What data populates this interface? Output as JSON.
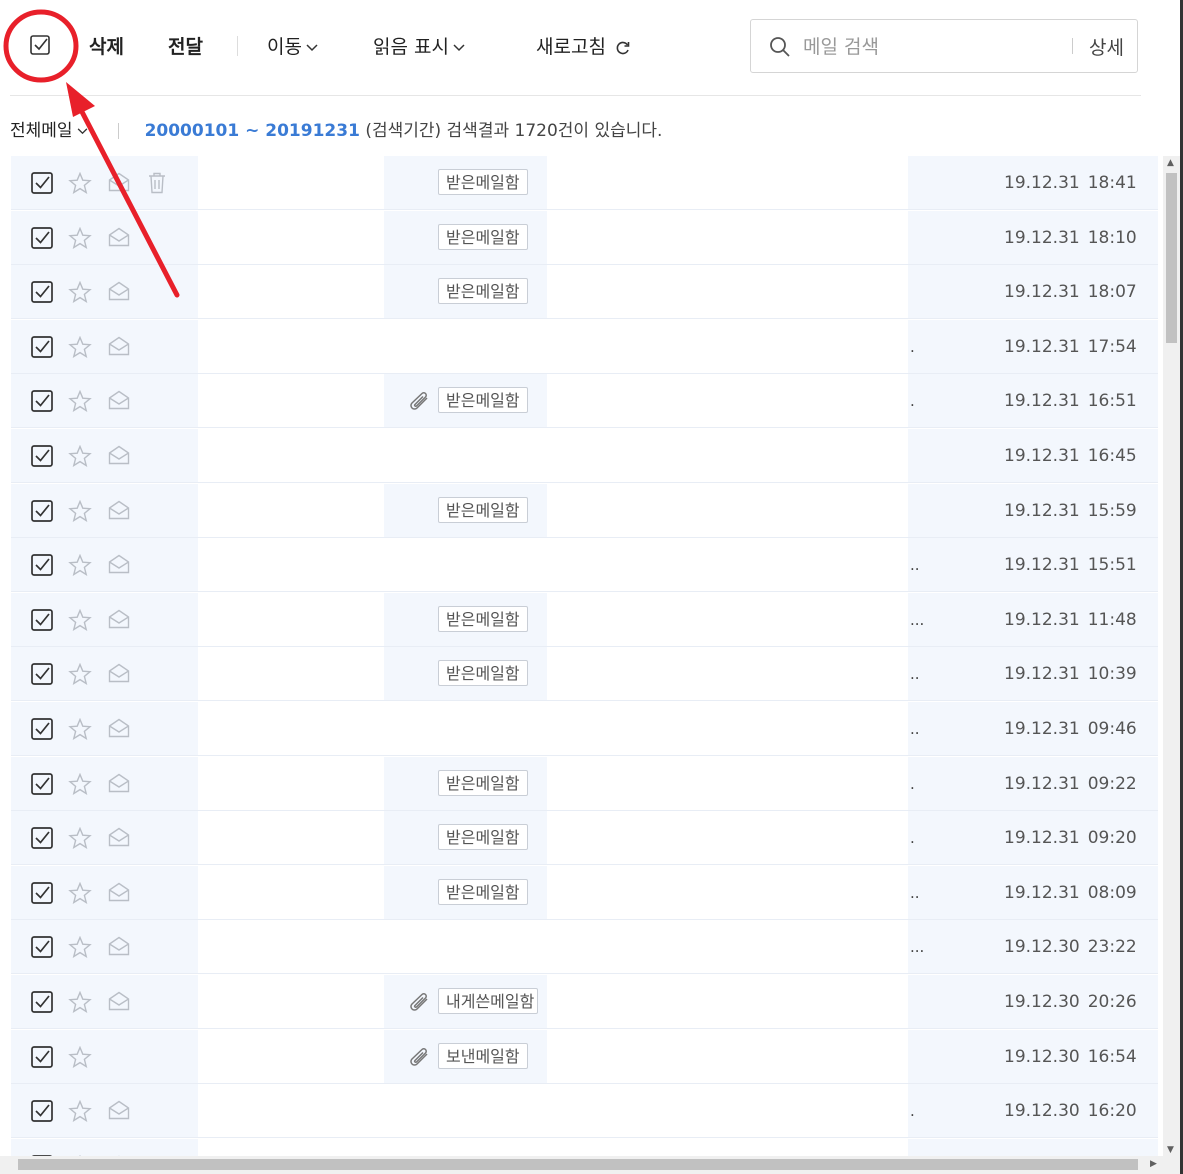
{
  "toolbar": {
    "delete_label": "삭제",
    "forward_label": "전달",
    "move_label": "이동",
    "mark_read_label": "읽음 표시",
    "refresh_label": "새로고침"
  },
  "search": {
    "placeholder": "메일 검색",
    "detail_label": "상세"
  },
  "filter": {
    "mailbox_label": "전체메일",
    "date_range": "20000101 ~ 20191231",
    "result_text": "(검색기간) 검색결과 1720건이 있습니다."
  },
  "emails": [
    {
      "folder": "받은메일함",
      "attachment": false,
      "date": "19.12.31",
      "time": "18:41",
      "tail": "",
      "read": true
    },
    {
      "folder": "받은메일함",
      "attachment": false,
      "date": "19.12.31",
      "time": "18:10",
      "tail": "",
      "read": true
    },
    {
      "folder": "받은메일함",
      "attachment": false,
      "date": "19.12.31",
      "time": "18:07",
      "tail": "",
      "read": true
    },
    {
      "folder": "",
      "attachment": false,
      "date": "19.12.31",
      "time": "17:54",
      "tail": ".",
      "read": true
    },
    {
      "folder": "받은메일함",
      "attachment": true,
      "date": "19.12.31",
      "time": "16:51",
      "tail": ".",
      "read": true
    },
    {
      "folder": "",
      "attachment": false,
      "date": "19.12.31",
      "time": "16:45",
      "tail": "",
      "read": true
    },
    {
      "folder": "받은메일함",
      "attachment": false,
      "date": "19.12.31",
      "time": "15:59",
      "tail": "",
      "read": true
    },
    {
      "folder": "",
      "attachment": false,
      "date": "19.12.31",
      "time": "15:51",
      "tail": "..",
      "read": true
    },
    {
      "folder": "받은메일함",
      "attachment": false,
      "date": "19.12.31",
      "time": "11:48",
      "tail": "...",
      "read": true
    },
    {
      "folder": "받은메일함",
      "attachment": false,
      "date": "19.12.31",
      "time": "10:39",
      "tail": "..",
      "read": true
    },
    {
      "folder": "",
      "attachment": false,
      "date": "19.12.31",
      "time": "09:46",
      "tail": "..",
      "read": true
    },
    {
      "folder": "받은메일함",
      "attachment": false,
      "date": "19.12.31",
      "time": "09:22",
      "tail": ".",
      "read": true
    },
    {
      "folder": "받은메일함",
      "attachment": false,
      "date": "19.12.31",
      "time": "09:20",
      "tail": ".",
      "read": true
    },
    {
      "folder": "받은메일함",
      "attachment": false,
      "date": "19.12.31",
      "time": "08:09",
      "tail": "..",
      "read": true
    },
    {
      "folder": "",
      "attachment": false,
      "date": "19.12.30",
      "time": "23:22",
      "tail": "...",
      "read": true
    },
    {
      "folder": "내게쓴메일함",
      "attachment": true,
      "date": "19.12.30",
      "time": "20:26",
      "tail": "",
      "read": true
    },
    {
      "folder": "보낸메일함",
      "attachment": true,
      "date": "19.12.30",
      "time": "16:54",
      "tail": "",
      "read": true
    },
    {
      "folder": "",
      "attachment": false,
      "date": "19.12.30",
      "time": "16:20",
      "tail": ".",
      "read": true
    },
    {
      "folder": "",
      "attachment": false,
      "date": "",
      "time": "",
      "tail": "",
      "read": true
    }
  ],
  "colors": {
    "accent": "#3a7bd5",
    "annotation": "#e8202a",
    "row_read_bg": "#f3f7fd"
  }
}
